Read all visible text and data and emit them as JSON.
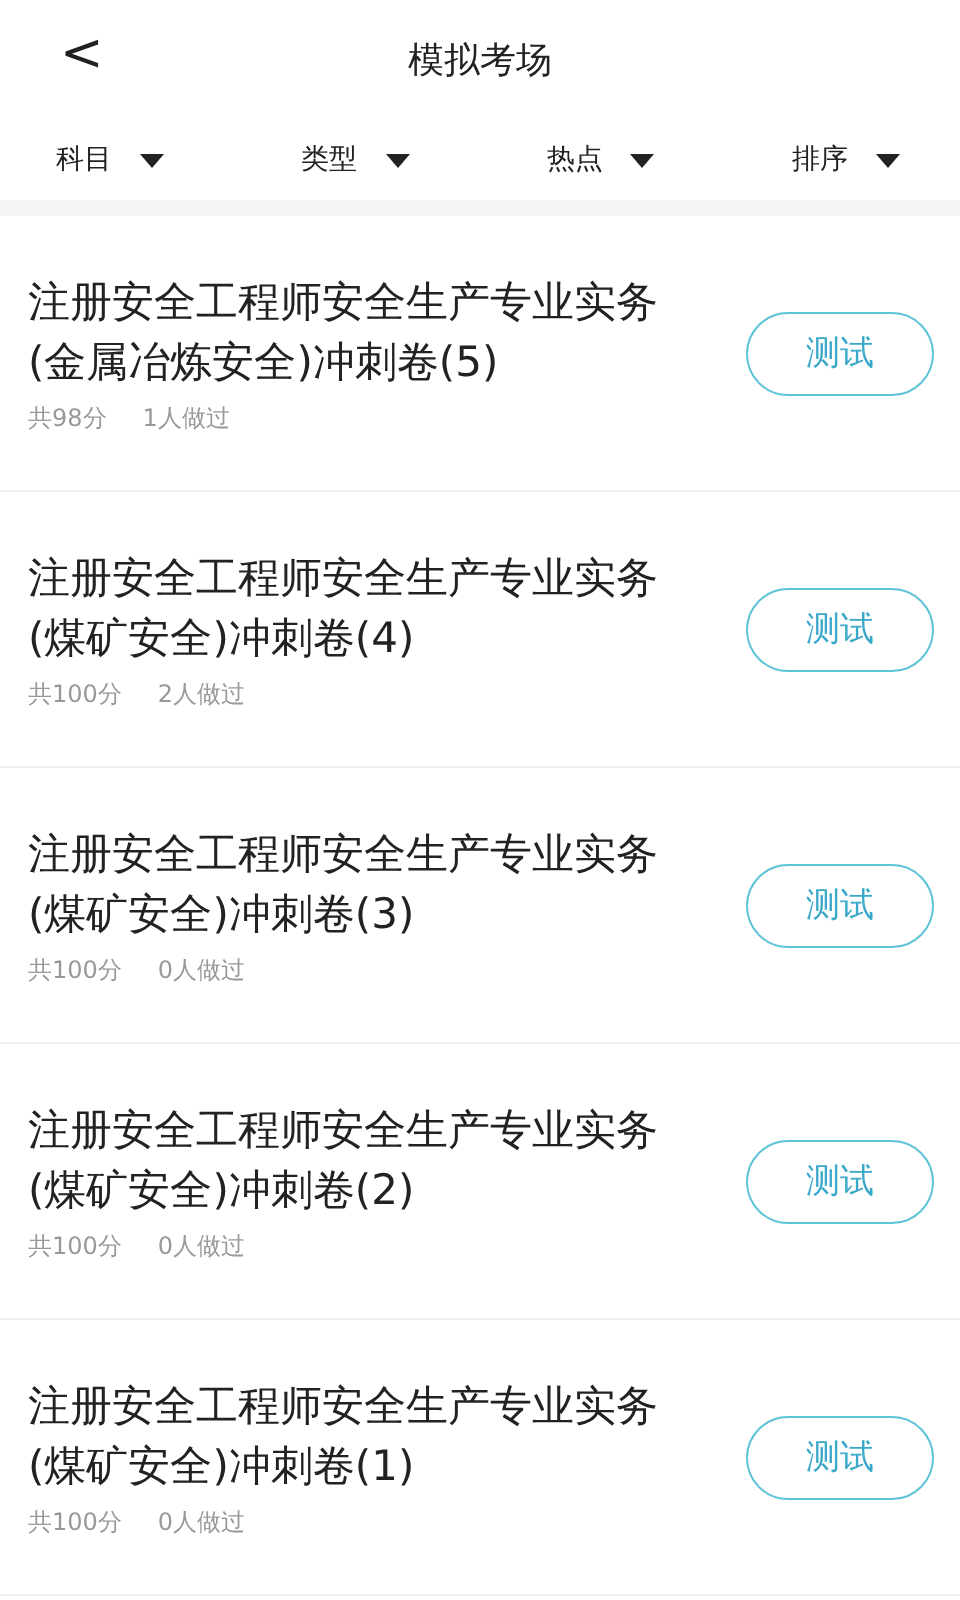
{
  "header": {
    "back": "<",
    "title": "模拟考场"
  },
  "filters": [
    {
      "label": "科目"
    },
    {
      "label": "类型"
    },
    {
      "label": "热点"
    },
    {
      "label": "排序"
    }
  ],
  "exams": [
    {
      "title": "注册安全工程师安全生产专业实务(金属冶炼安全)冲刺卷(5)",
      "score": "共98分",
      "takers": "1人做过",
      "button": "测试"
    },
    {
      "title": "注册安全工程师安全生产专业实务(煤矿安全)冲刺卷(4)",
      "score": "共100分",
      "takers": "2人做过",
      "button": "测试"
    },
    {
      "title": "注册安全工程师安全生产专业实务(煤矿安全)冲刺卷(3)",
      "score": "共100分",
      "takers": "0人做过",
      "button": "测试"
    },
    {
      "title": "注册安全工程师安全生产专业实务(煤矿安全)冲刺卷(2)",
      "score": "共100分",
      "takers": "0人做过",
      "button": "测试"
    },
    {
      "title": "注册安全工程师安全生产专业实务(煤矿安全)冲刺卷(1)",
      "score": "共100分",
      "takers": "0人做过",
      "button": "测试"
    }
  ]
}
